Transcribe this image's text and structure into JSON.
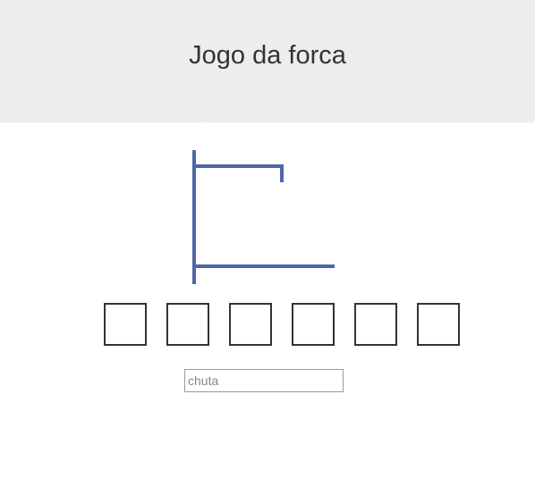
{
  "header": {
    "title": "Jogo da forca"
  },
  "game": {
    "gallows_stage": 0,
    "gallows_color": "#4f67a8",
    "letters": [
      "",
      "",
      "",
      "",
      "",
      ""
    ]
  },
  "guess": {
    "value": "",
    "placeholder": "chuta"
  }
}
